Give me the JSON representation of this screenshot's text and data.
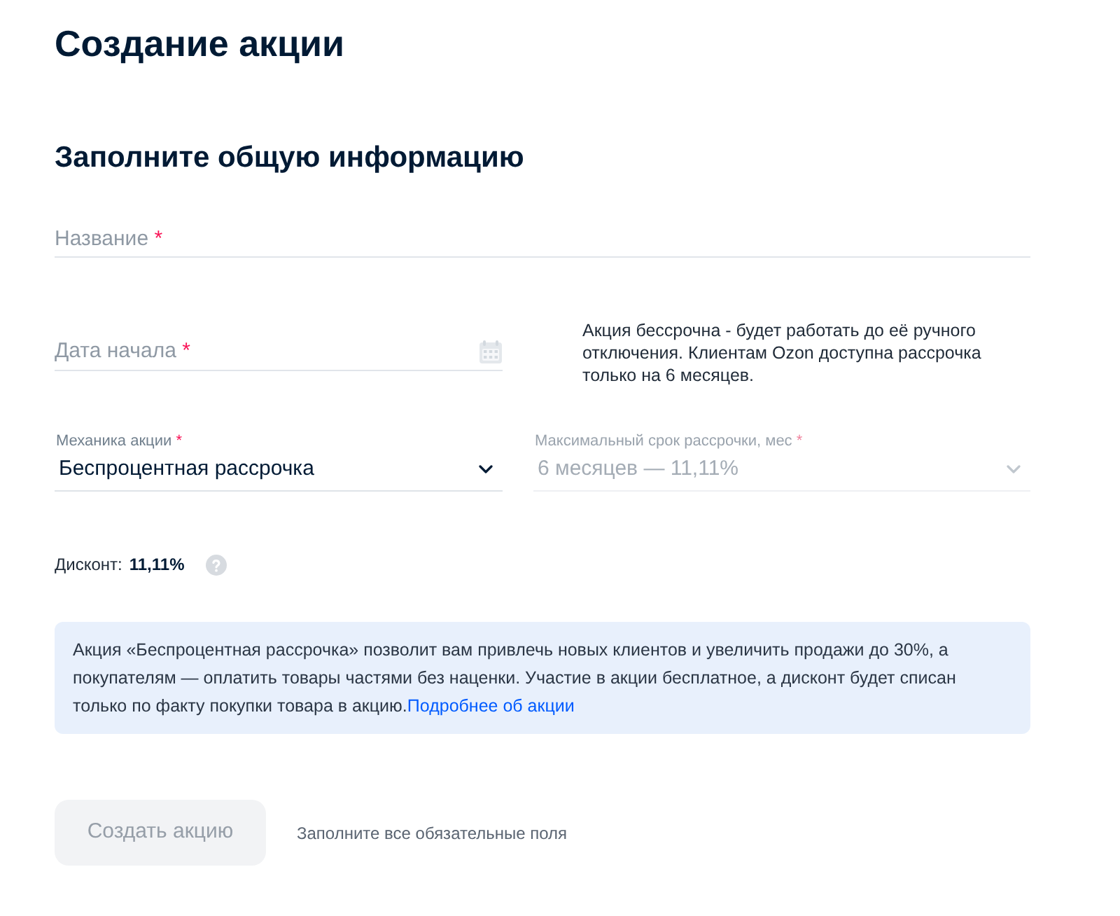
{
  "page_title": "Создание акции",
  "section_title": "Заполните общую информацию",
  "name_field": {
    "placeholder": "Название",
    "required_mark": "*"
  },
  "date_field": {
    "placeholder": "Дата начала",
    "required_mark": "*"
  },
  "date_note": "Акция бессрочна - будет работать до её ручного отключения. Клиентам Ozon доступна рассрочка только на 6 месяцев.",
  "selects": [
    {
      "label": "Механика акции",
      "required_mark": "*",
      "value": "Беспроцентная рассрочка",
      "disabled": false
    },
    {
      "label": "Максимальный срок рассрочки, мес",
      "required_mark": "*",
      "value": "6 месяцев — 11,11%",
      "disabled": true
    }
  ],
  "discount": {
    "label": "Дисконт:",
    "value": "11,11%"
  },
  "info_banner": {
    "text": "Акция «Беспроцентная рассрочка» позволит вам привлечь новых клиентов и увеличить продажи до 30%, а покупателям — оплатить товары частями без наценки. Участие в акции бесплатное, а дисконт будет списан только по факту покупки товара в акцию.",
    "link": "Подробнее об акции"
  },
  "submit_button": {
    "label": "Создать акцию",
    "disabled": true
  },
  "submit_hint": "Заполните все обязательные поля"
}
